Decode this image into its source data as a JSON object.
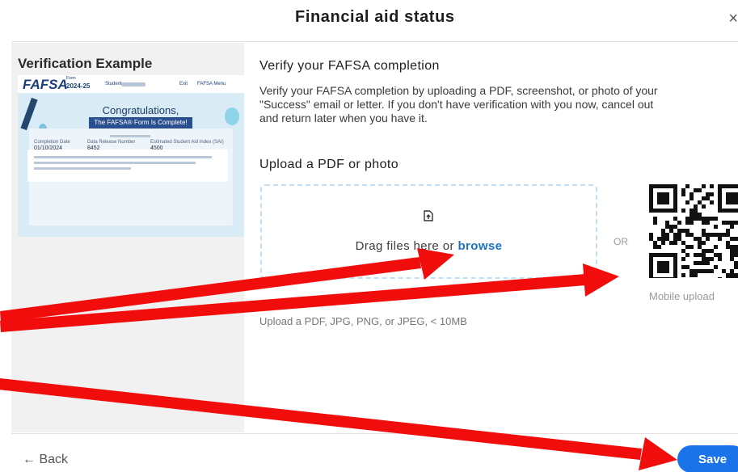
{
  "dialog": {
    "title": "Financial aid status",
    "close_glyph": "×"
  },
  "example": {
    "title": "Verification Example",
    "fafsa": {
      "logo": "FAFSA",
      "form_label": "Form",
      "year": "2024-25",
      "student_label": "Student",
      "exit_label": "Exit",
      "menu_label": "FAFSA Menu",
      "congrats": "Congratulations,",
      "complete": "The FAFSA® Form Is Complete!",
      "completion_label": "Completion Date",
      "completion_value": "01/10/2024",
      "receipt_label": "Data Release Number",
      "receipt_value": "8452",
      "sai_label": "Estimated Student Aid Index (SAI)",
      "sai_value": "4500"
    }
  },
  "main": {
    "heading": "Verify your FAFSA completion",
    "desc_lines": [
      "Verify your FAFSA completion by uploading a PDF, screenshot, or photo of your",
      "\"Success\" email or letter. If you don't have verification with you now, cancel out",
      "and return later when you have it."
    ],
    "upload_heading": "Upload a PDF or photo",
    "drag_text": "Drag files here or ",
    "browse_label": "browse",
    "or_label": "OR",
    "mobile_label": "Mobile upload",
    "hint": "Upload a PDF, JPG, PNG, or JPEG, < 10MB"
  },
  "footer": {
    "back_label": "← Back",
    "save_label": "Save"
  },
  "colors": {
    "accent": "#1a73e8",
    "annotation": "#ff0000"
  },
  "icons": [
    "upload-file-icon",
    "qr-code-icon",
    "close-icon"
  ]
}
